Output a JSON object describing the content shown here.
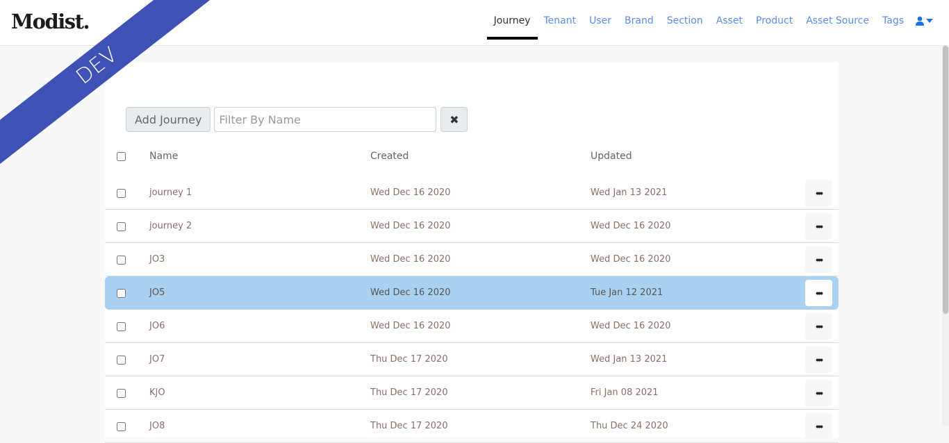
{
  "app": {
    "logo": "Modist.",
    "env_badge": "DEV"
  },
  "nav": {
    "items": [
      {
        "label": "Journey",
        "active": true
      },
      {
        "label": "Tenant"
      },
      {
        "label": "User"
      },
      {
        "label": "Brand"
      },
      {
        "label": "Section"
      },
      {
        "label": "Asset"
      },
      {
        "label": "Product"
      },
      {
        "label": "Asset Source"
      },
      {
        "label": "Tags"
      }
    ],
    "user_icon": "user-icon"
  },
  "toolbar": {
    "add_label": "Add Journey",
    "filter_placeholder": "Filter By Name",
    "filter_value": "",
    "clear_icon": "✖"
  },
  "table": {
    "headers": {
      "name": "Name",
      "created": "Created",
      "updated": "Updated"
    },
    "rows": [
      {
        "name": "journey 1",
        "created": "Wed Dec 16 2020",
        "updated": "Wed Jan 13 2021"
      },
      {
        "name": "journey 2",
        "created": "Wed Dec 16 2020",
        "updated": "Wed Dec 16 2020"
      },
      {
        "name": "JO3",
        "created": "Wed Dec 16 2020",
        "updated": "Wed Dec 16 2020"
      },
      {
        "name": "JO5",
        "created": "Wed Dec 16 2020",
        "updated": "Tue Jan 12 2021",
        "selected": true
      },
      {
        "name": "JO6",
        "created": "Wed Dec 16 2020",
        "updated": "Wed Dec 16 2020"
      },
      {
        "name": "JO7",
        "created": "Thu Dec 17 2020",
        "updated": "Wed Jan 13 2021"
      },
      {
        "name": "KJO",
        "created": "Thu Dec 17 2020",
        "updated": "Fri Jan 08 2021"
      },
      {
        "name": "JO8",
        "created": "Thu Dec 17 2020",
        "updated": "Thu Dec 24 2020"
      }
    ],
    "more_label": "•••"
  },
  "colors": {
    "accent": "#5b8def",
    "ribbon": "#3f51b5",
    "selected_row": "#aad1f0"
  }
}
